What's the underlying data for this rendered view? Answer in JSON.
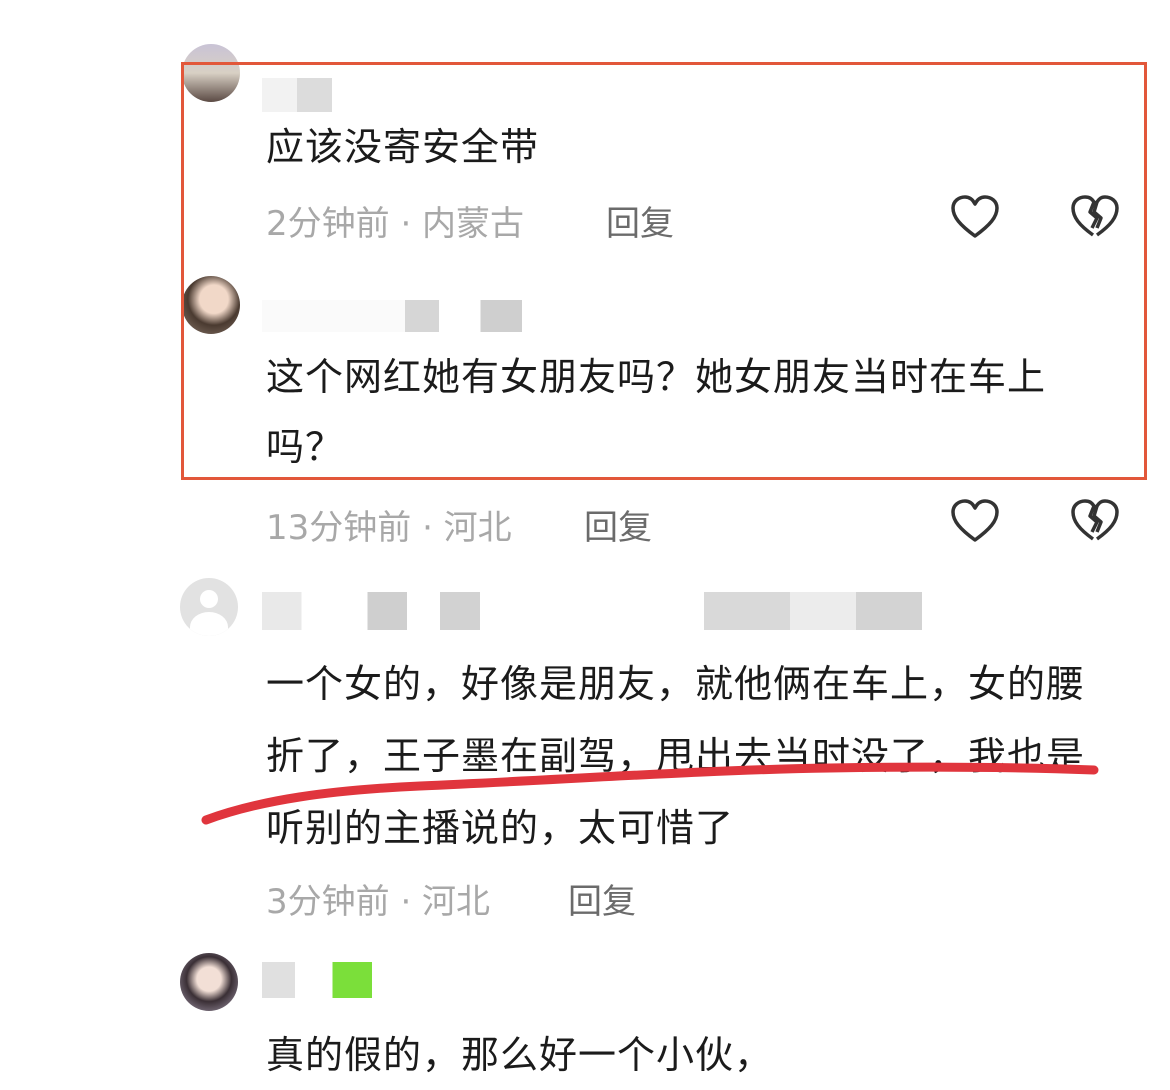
{
  "comments": [
    {
      "text": "应该没寄安全带",
      "meta": "2分钟前 · 内蒙古",
      "reply_label": "回复",
      "like_icon": "heart-outline-icon",
      "dislike_icon": "broken-heart-icon"
    },
    {
      "text": "这个网红她有女朋友吗？她女朋友当时在车上吗？",
      "meta": "13分钟前 · 河北",
      "reply_label": "回复",
      "like_icon": "heart-outline-icon",
      "dislike_icon": "broken-heart-icon"
    },
    {
      "text": "一个女的，好像是朋友，就他俩在车上，女的腰折了，王子墨在副驾，甩出去当时没了，我也是听别的主播说的，太可惜了",
      "meta": "3分钟前 · 河北",
      "reply_label": "回复"
    },
    {
      "text": "真的假的，那么好一个小伙，"
    }
  ],
  "annotation_colors": {
    "highlight_box": "#e2573a",
    "underline": "#e0353d"
  },
  "avatar_placeholder_icon": "default-avatar-icon"
}
